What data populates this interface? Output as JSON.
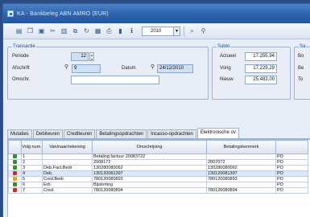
{
  "window": {
    "title": "KA - Bankbeleg ABN AMRO (EUR)"
  },
  "toolbar": {
    "icons": [
      "page-icon",
      "copy-icon",
      "save-icon",
      "cut-icon",
      "paste-icon",
      "duplicate-icon",
      "refresh-icon",
      "report-icon",
      "print-icon",
      "chart-icon",
      "info-icon",
      "search-icon",
      "filter-icon"
    ],
    "year_value": "2010"
  },
  "transaction": {
    "group_title": "Transactie",
    "period_label": "Periode",
    "period_value": "12",
    "statement_label": "Afschrift",
    "statement_value": "9",
    "date_label": "Datum",
    "date_value": "24/12/2010",
    "description_label": "Omschr."
  },
  "balance": {
    "group_title": "Saldo",
    "current_label": "Actueel",
    "current_value": "17.255,94",
    "previous_label": "Vorig",
    "previous_value": "17.229,29",
    "new_label": "Nieuw",
    "new_value": "25.483,00"
  },
  "right_group": {
    "group_title": "Sa",
    "label1": "Bo",
    "label2": "Be",
    "label3": "To"
  },
  "tabs": [
    {
      "label": "Mutaties"
    },
    {
      "label": "Debiteuren"
    },
    {
      "label": "Crediteuren"
    },
    {
      "label": "Betalingsopdrachten"
    },
    {
      "label": "Incasso-opdrachten"
    },
    {
      "label": "Elektronische ov",
      "active": true
    }
  ],
  "grid": {
    "columns": [
      "",
      "Volg num.",
      "Van/naar/rekening",
      "Omschrijving",
      "Betalingskenmerk",
      ""
    ],
    "rows": [
      {
        "status_color": "#3a8a3a",
        "seq": "1",
        "account": "",
        "description": "Betaling factuur 20083722",
        "reference": "",
        "code": "PO"
      },
      {
        "status_color": "#3a8a3a",
        "seq": "2",
        "account": "",
        "description": "2008172",
        "reference": "2807072",
        "code": "PO"
      },
      {
        "status_color": "#3a8a3a",
        "seq": "3",
        "account": "Deb.Fact.Bedr",
        "description": "130280080062",
        "reference": "130280080062",
        "code": "PO"
      },
      {
        "status_color": "#c23030",
        "seq": "4",
        "account": "Deb.",
        "description": "130120081397",
        "reference": "130120081397",
        "code": "PO"
      },
      {
        "status_color": "#e2a12b",
        "seq": "5",
        "account": "Cred.Bedr.",
        "description": "780120080893",
        "reference": "780120080893",
        "code": "PO"
      },
      {
        "status_color": "#3a8a3a",
        "seq": "6",
        "account": "Erb.",
        "description": "Bijstorting",
        "reference": "",
        "code": "PO"
      },
      {
        "status_color": "#c23030",
        "seq": "7",
        "account": "Cred.",
        "description": "780120080894",
        "reference": "780120080894",
        "code": "PO"
      }
    ]
  }
}
